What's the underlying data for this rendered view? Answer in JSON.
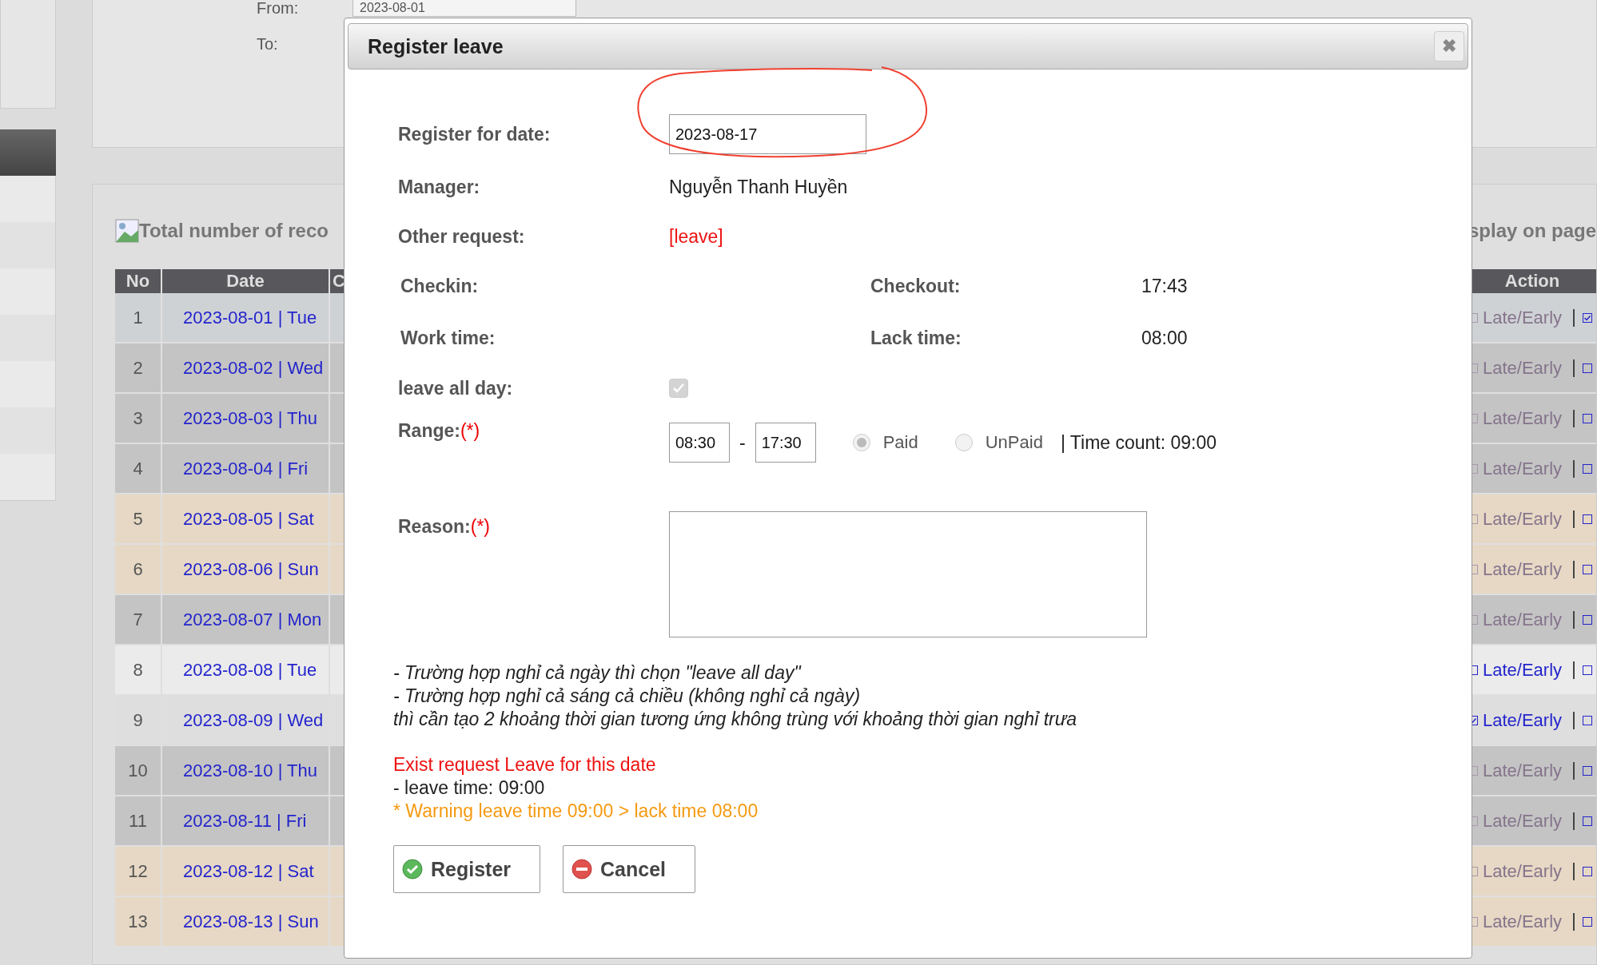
{
  "filter": {
    "from_label": "From:",
    "from_value": "2023-08-01",
    "to_label": "To:"
  },
  "list": {
    "summary_left": "Total number of reco",
    "summary_right": "splay on page",
    "columns": [
      "No",
      "Date",
      "C",
      "Action"
    ],
    "rows": [
      {
        "no": "1",
        "date": "2023-08-01 | Tue",
        "color": "#cfd2d5",
        "late_early": "Late/Early",
        "enabled": false,
        "checked": false,
        "mark_checked": true
      },
      {
        "no": "2",
        "date": "2023-08-02 | Wed",
        "color": "#c4c4c4",
        "late_early": "Late/Early",
        "enabled": false,
        "checked": false,
        "mark_checked": false
      },
      {
        "no": "3",
        "date": "2023-08-03 | Thu",
        "color": "#c4c4c4",
        "late_early": "Late/Early",
        "enabled": false,
        "checked": false,
        "mark_checked": false
      },
      {
        "no": "4",
        "date": "2023-08-04 | Fri",
        "color": "#c4c4c4",
        "late_early": "Late/Early",
        "enabled": false,
        "checked": false,
        "mark_checked": false
      },
      {
        "no": "5",
        "date": "2023-08-05 | Sat",
        "color": "#e6d8c4",
        "late_early": "Late/Early",
        "enabled": false,
        "checked": false,
        "mark_checked": false
      },
      {
        "no": "6",
        "date": "2023-08-06 | Sun",
        "color": "#e6d8c4",
        "late_early": "Late/Early",
        "enabled": false,
        "checked": false,
        "mark_checked": false
      },
      {
        "no": "7",
        "date": "2023-08-07 | Mon",
        "color": "#c4c4c4",
        "late_early": "Late/Early",
        "enabled": false,
        "checked": false,
        "mark_checked": false
      },
      {
        "no": "8",
        "date": "2023-08-08 | Tue",
        "color": "#ebebeb",
        "late_early": "Late/Early",
        "enabled": true,
        "checked": false,
        "mark_checked": false
      },
      {
        "no": "9",
        "date": "2023-08-09 | Wed",
        "color": "#dedede",
        "late_early": "Late/Early",
        "enabled": true,
        "checked": true,
        "mark_checked": false
      },
      {
        "no": "10",
        "date": "2023-08-10 | Thu",
        "color": "#c4c4c4",
        "late_early": "Late/Early",
        "enabled": false,
        "checked": false,
        "mark_checked": false
      },
      {
        "no": "11",
        "date": "2023-08-11 | Fri",
        "color": "#c4c4c4",
        "late_early": "Late/Early",
        "enabled": false,
        "checked": false,
        "mark_checked": false
      },
      {
        "no": "12",
        "date": "2023-08-12 | Sat",
        "color": "#e6d8c4",
        "late_early": "Late/Early",
        "enabled": false,
        "checked": false,
        "mark_checked": false
      },
      {
        "no": "13",
        "date": "2023-08-13 | Sun",
        "color": "#e6d8c4",
        "late_early": "Late/Early",
        "enabled": false,
        "checked": false,
        "mark_checked": false
      }
    ]
  },
  "dialog": {
    "title": "Register leave",
    "close": "✖",
    "date_label": "Register for date:",
    "date_value": "2023-08-17",
    "manager_label": "Manager:",
    "manager": "Nguyễn Thanh Huyền",
    "other_label": "Other request:",
    "other_value": "[leave]",
    "checkin_label": "Checkin:",
    "checkout_label": "Checkout:",
    "checkout_value": "17:43",
    "worktime_label": "Work time:",
    "lack_label": "Lack time:",
    "lack_value": "08:00",
    "all_day_label": "leave all day:",
    "all_day": {
      "checked": true,
      "disabled": true
    },
    "range_label": "Range:",
    "required": "(*)",
    "range_from": "08:30",
    "range_sep": "-",
    "range_to": "17:30",
    "pay_options": [
      {
        "label": "Paid",
        "selected": true
      },
      {
        "label": "UnPaid",
        "selected": false
      }
    ],
    "time_count": "| Time count: 09:00",
    "reason_label": "Reason:",
    "reason_required": "(*)",
    "notes": [
      "- Trường hợp nghỉ cả ngày thì chọn \"leave all day\"",
      "- Trường hợp nghỉ cả sáng cả chiều (không nghỉ cả ngày)",
      "thì cần tạo 2 khoảng thời gian tương ứng không trùng với khoảng thời gian nghỉ trưa"
    ],
    "exist_message": "Exist request Leave for this date",
    "leave_time": "- leave time: 09:00",
    "warning": "* Warning leave time 09:00 > lack time 08:00",
    "buttons": [
      {
        "kind": "register",
        "label": "Register"
      },
      {
        "kind": "cancel",
        "label": "Cancel"
      }
    ]
  }
}
